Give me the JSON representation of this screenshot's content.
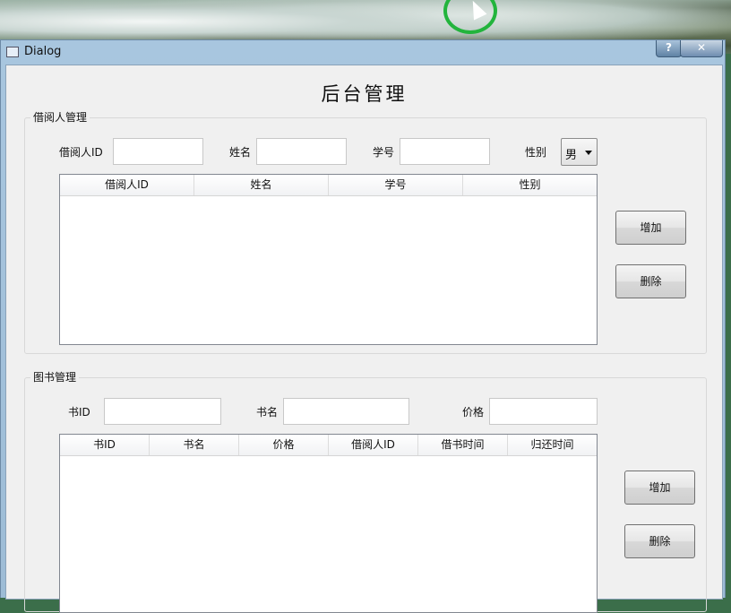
{
  "window": {
    "title": "Dialog",
    "help_label": "?",
    "close_label": "✕"
  },
  "heading": "后台管理",
  "borrower_section": {
    "title": "借阅人管理",
    "labels": {
      "id": "借阅人ID",
      "name": "姓名",
      "student_no": "学号",
      "gender": "性别"
    },
    "gender_value": "男",
    "columns": [
      "借阅人ID",
      "姓名",
      "学号",
      "性别"
    ],
    "add_label": "增加",
    "delete_label": "删除"
  },
  "book_section": {
    "title": "图书管理",
    "labels": {
      "id": "书ID",
      "name": "书名",
      "price": "价格"
    },
    "columns": [
      "书ID",
      "书名",
      "价格",
      "借阅人ID",
      "借书时间",
      "归还时间"
    ],
    "add_label": "增加",
    "delete_label": "删除"
  }
}
